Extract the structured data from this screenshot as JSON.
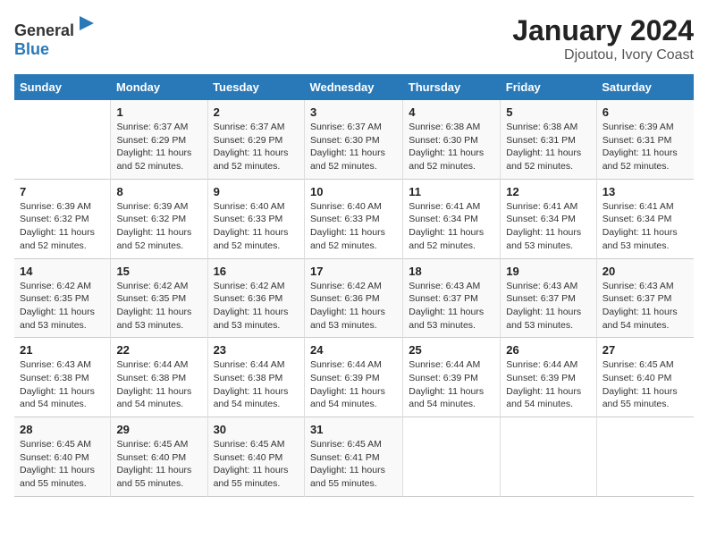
{
  "header": {
    "logo_general": "General",
    "logo_blue": "Blue",
    "title": "January 2024",
    "subtitle": "Djoutou, Ivory Coast"
  },
  "days_of_week": [
    "Sunday",
    "Monday",
    "Tuesday",
    "Wednesday",
    "Thursday",
    "Friday",
    "Saturday"
  ],
  "weeks": [
    [
      {
        "day": "",
        "sunrise": "",
        "sunset": "",
        "daylight": ""
      },
      {
        "day": "1",
        "sunrise": "Sunrise: 6:37 AM",
        "sunset": "Sunset: 6:29 PM",
        "daylight": "Daylight: 11 hours and 52 minutes."
      },
      {
        "day": "2",
        "sunrise": "Sunrise: 6:37 AM",
        "sunset": "Sunset: 6:29 PM",
        "daylight": "Daylight: 11 hours and 52 minutes."
      },
      {
        "day": "3",
        "sunrise": "Sunrise: 6:37 AM",
        "sunset": "Sunset: 6:30 PM",
        "daylight": "Daylight: 11 hours and 52 minutes."
      },
      {
        "day": "4",
        "sunrise": "Sunrise: 6:38 AM",
        "sunset": "Sunset: 6:30 PM",
        "daylight": "Daylight: 11 hours and 52 minutes."
      },
      {
        "day": "5",
        "sunrise": "Sunrise: 6:38 AM",
        "sunset": "Sunset: 6:31 PM",
        "daylight": "Daylight: 11 hours and 52 minutes."
      },
      {
        "day": "6",
        "sunrise": "Sunrise: 6:39 AM",
        "sunset": "Sunset: 6:31 PM",
        "daylight": "Daylight: 11 hours and 52 minutes."
      }
    ],
    [
      {
        "day": "7",
        "sunrise": "Sunrise: 6:39 AM",
        "sunset": "Sunset: 6:32 PM",
        "daylight": "Daylight: 11 hours and 52 minutes."
      },
      {
        "day": "8",
        "sunrise": "Sunrise: 6:39 AM",
        "sunset": "Sunset: 6:32 PM",
        "daylight": "Daylight: 11 hours and 52 minutes."
      },
      {
        "day": "9",
        "sunrise": "Sunrise: 6:40 AM",
        "sunset": "Sunset: 6:33 PM",
        "daylight": "Daylight: 11 hours and 52 minutes."
      },
      {
        "day": "10",
        "sunrise": "Sunrise: 6:40 AM",
        "sunset": "Sunset: 6:33 PM",
        "daylight": "Daylight: 11 hours and 52 minutes."
      },
      {
        "day": "11",
        "sunrise": "Sunrise: 6:41 AM",
        "sunset": "Sunset: 6:34 PM",
        "daylight": "Daylight: 11 hours and 52 minutes."
      },
      {
        "day": "12",
        "sunrise": "Sunrise: 6:41 AM",
        "sunset": "Sunset: 6:34 PM",
        "daylight": "Daylight: 11 hours and 53 minutes."
      },
      {
        "day": "13",
        "sunrise": "Sunrise: 6:41 AM",
        "sunset": "Sunset: 6:34 PM",
        "daylight": "Daylight: 11 hours and 53 minutes."
      }
    ],
    [
      {
        "day": "14",
        "sunrise": "Sunrise: 6:42 AM",
        "sunset": "Sunset: 6:35 PM",
        "daylight": "Daylight: 11 hours and 53 minutes."
      },
      {
        "day": "15",
        "sunrise": "Sunrise: 6:42 AM",
        "sunset": "Sunset: 6:35 PM",
        "daylight": "Daylight: 11 hours and 53 minutes."
      },
      {
        "day": "16",
        "sunrise": "Sunrise: 6:42 AM",
        "sunset": "Sunset: 6:36 PM",
        "daylight": "Daylight: 11 hours and 53 minutes."
      },
      {
        "day": "17",
        "sunrise": "Sunrise: 6:42 AM",
        "sunset": "Sunset: 6:36 PM",
        "daylight": "Daylight: 11 hours and 53 minutes."
      },
      {
        "day": "18",
        "sunrise": "Sunrise: 6:43 AM",
        "sunset": "Sunset: 6:37 PM",
        "daylight": "Daylight: 11 hours and 53 minutes."
      },
      {
        "day": "19",
        "sunrise": "Sunrise: 6:43 AM",
        "sunset": "Sunset: 6:37 PM",
        "daylight": "Daylight: 11 hours and 53 minutes."
      },
      {
        "day": "20",
        "sunrise": "Sunrise: 6:43 AM",
        "sunset": "Sunset: 6:37 PM",
        "daylight": "Daylight: 11 hours and 54 minutes."
      }
    ],
    [
      {
        "day": "21",
        "sunrise": "Sunrise: 6:43 AM",
        "sunset": "Sunset: 6:38 PM",
        "daylight": "Daylight: 11 hours and 54 minutes."
      },
      {
        "day": "22",
        "sunrise": "Sunrise: 6:44 AM",
        "sunset": "Sunset: 6:38 PM",
        "daylight": "Daylight: 11 hours and 54 minutes."
      },
      {
        "day": "23",
        "sunrise": "Sunrise: 6:44 AM",
        "sunset": "Sunset: 6:38 PM",
        "daylight": "Daylight: 11 hours and 54 minutes."
      },
      {
        "day": "24",
        "sunrise": "Sunrise: 6:44 AM",
        "sunset": "Sunset: 6:39 PM",
        "daylight": "Daylight: 11 hours and 54 minutes."
      },
      {
        "day": "25",
        "sunrise": "Sunrise: 6:44 AM",
        "sunset": "Sunset: 6:39 PM",
        "daylight": "Daylight: 11 hours and 54 minutes."
      },
      {
        "day": "26",
        "sunrise": "Sunrise: 6:44 AM",
        "sunset": "Sunset: 6:39 PM",
        "daylight": "Daylight: 11 hours and 54 minutes."
      },
      {
        "day": "27",
        "sunrise": "Sunrise: 6:45 AM",
        "sunset": "Sunset: 6:40 PM",
        "daylight": "Daylight: 11 hours and 55 minutes."
      }
    ],
    [
      {
        "day": "28",
        "sunrise": "Sunrise: 6:45 AM",
        "sunset": "Sunset: 6:40 PM",
        "daylight": "Daylight: 11 hours and 55 minutes."
      },
      {
        "day": "29",
        "sunrise": "Sunrise: 6:45 AM",
        "sunset": "Sunset: 6:40 PM",
        "daylight": "Daylight: 11 hours and 55 minutes."
      },
      {
        "day": "30",
        "sunrise": "Sunrise: 6:45 AM",
        "sunset": "Sunset: 6:40 PM",
        "daylight": "Daylight: 11 hours and 55 minutes."
      },
      {
        "day": "31",
        "sunrise": "Sunrise: 6:45 AM",
        "sunset": "Sunset: 6:41 PM",
        "daylight": "Daylight: 11 hours and 55 minutes."
      },
      {
        "day": "",
        "sunrise": "",
        "sunset": "",
        "daylight": ""
      },
      {
        "day": "",
        "sunrise": "",
        "sunset": "",
        "daylight": ""
      },
      {
        "day": "",
        "sunrise": "",
        "sunset": "",
        "daylight": ""
      }
    ]
  ]
}
